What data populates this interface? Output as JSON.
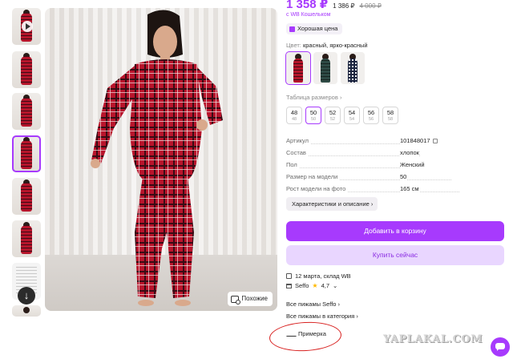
{
  "thumbnails": [
    {
      "kind": "video"
    },
    {
      "kind": "photo"
    },
    {
      "kind": "photo"
    },
    {
      "kind": "photo",
      "active": true
    },
    {
      "kind": "photo"
    },
    {
      "kind": "photo"
    },
    {
      "kind": "document"
    },
    {
      "kind": "photo"
    }
  ],
  "gallery": {
    "similar_label": "Похожие",
    "scroll_icon": "arrow-down-icon"
  },
  "price": {
    "current": "1 358 ₽",
    "wb_price": "1 386 ₽",
    "old": "4 000 ₽",
    "wallet_note": "с WB Кошельком",
    "good_price_badge": "Хорошая цена"
  },
  "color": {
    "label": "Цвет:",
    "value": "красный, ярко-красный",
    "swatches": [
      {
        "color": "#b5152b",
        "active": true
      },
      {
        "color": "#2e4a45",
        "active": false
      },
      {
        "color": "#1c2540",
        "active": false
      }
    ]
  },
  "sizes": {
    "label": "Таблица размеров",
    "chevron": "›",
    "items": [
      {
        "size": "48",
        "ru": "48",
        "active": false
      },
      {
        "size": "50",
        "ru": "50",
        "active": true
      },
      {
        "size": "52",
        "ru": "52",
        "active": false
      },
      {
        "size": "54",
        "ru": "54",
        "active": false
      },
      {
        "size": "56",
        "ru": "56",
        "active": false
      },
      {
        "size": "58",
        "ru": "58",
        "active": false
      }
    ]
  },
  "specs": [
    {
      "key": "Артикул",
      "value": "101848017",
      "copy": true
    },
    {
      "key": "Состав",
      "value": "хлопок"
    },
    {
      "key": "Пол",
      "value": "Женский"
    },
    {
      "key": "Размер на модели",
      "value": "50"
    },
    {
      "key": "Рост модели на фото",
      "value": "165 см"
    }
  ],
  "buttons": {
    "characteristics": "Характеристики и описание ›",
    "add_to_cart": "Добавить в корзину",
    "buy_now": "Купить сейчас"
  },
  "delivery": "12 марта, склад WB",
  "seller": {
    "name": "Seffo",
    "rating": "4,7",
    "chevron": "⌄"
  },
  "links": {
    "all_seller": "Все пижамы Seffo ›",
    "all_category": "Все пижамы в категория ›"
  },
  "try_on": "Примерка",
  "watermark": "YAPLAKAL.COM",
  "colors": {
    "accent": "#a73afd",
    "accent_light": "#e9d6ff",
    "annotation": "#d8201f"
  }
}
